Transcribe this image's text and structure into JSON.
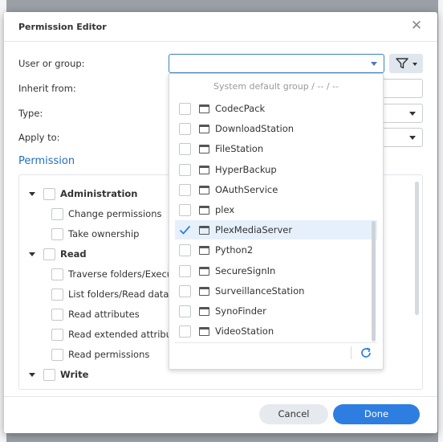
{
  "dialog": {
    "title": "Permission Editor",
    "close_glyph": "✕"
  },
  "form": {
    "user_or_group_label": "User or group:",
    "user_or_group_value": "",
    "inherit_from_label": "Inherit from:",
    "type_label": "Type:",
    "apply_to_label": "Apply to:"
  },
  "permission": {
    "section_title": "Permission",
    "items": [
      {
        "label": "Administration",
        "level": 0,
        "checked": false
      },
      {
        "label": "Change permissions",
        "level": 1,
        "checked": false
      },
      {
        "label": "Take ownership",
        "level": 1,
        "checked": false
      },
      {
        "label": "Read",
        "level": 0,
        "checked": false
      },
      {
        "label": "Traverse folders/Execute files",
        "level": 1,
        "checked": false
      },
      {
        "label": "List folders/Read data",
        "level": 1,
        "checked": false
      },
      {
        "label": "Read attributes",
        "level": 1,
        "checked": false
      },
      {
        "label": "Read extended attributes",
        "level": 1,
        "checked": false
      },
      {
        "label": "Read permissions",
        "level": 1,
        "checked": false
      },
      {
        "label": "Write",
        "level": 0,
        "checked": false
      }
    ]
  },
  "dropdown": {
    "header": "System default group / -- / --",
    "items": [
      {
        "label": "CodecPack",
        "checked": false
      },
      {
        "label": "DownloadStation",
        "checked": false
      },
      {
        "label": "FileStation",
        "checked": false
      },
      {
        "label": "HyperBackup",
        "checked": false
      },
      {
        "label": "OAuthService",
        "checked": false
      },
      {
        "label": "plex",
        "checked": false
      },
      {
        "label": "PlexMediaServer",
        "checked": true
      },
      {
        "label": "Python2",
        "checked": false
      },
      {
        "label": "SecureSignIn",
        "checked": false
      },
      {
        "label": "SurveillanceStation",
        "checked": false
      },
      {
        "label": "SynoFinder",
        "checked": false
      },
      {
        "label": "VideoStation",
        "checked": false
      }
    ],
    "search_value": ""
  },
  "footer": {
    "cancel_label": "Cancel",
    "done_label": "Done"
  },
  "colors": {
    "accent": "#2d7ee0",
    "section_title": "#1f6fc5",
    "selected_row": "#e6f0fb"
  },
  "icons": {
    "close": "close-icon",
    "filter": "filter-icon",
    "refresh": "refresh-icon",
    "window": "window-icon",
    "check": "check-icon"
  }
}
